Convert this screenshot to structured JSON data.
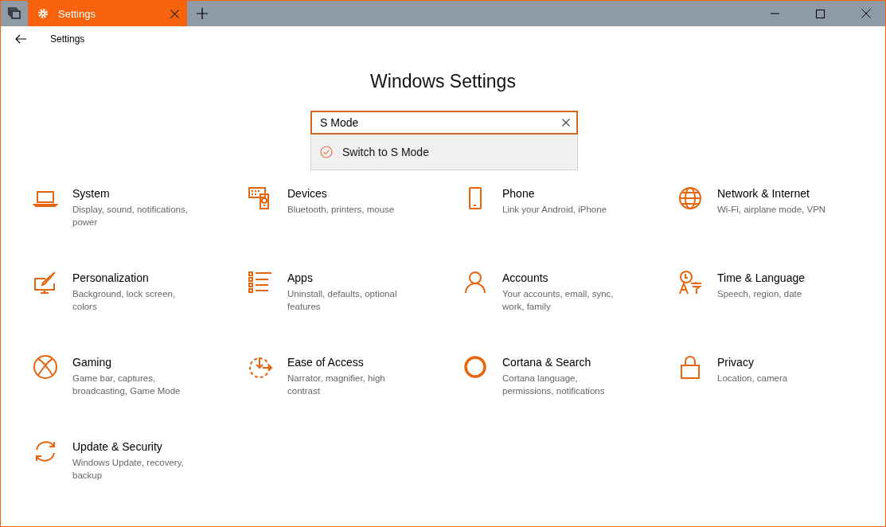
{
  "tabs": [
    {
      "label": "Settings",
      "selected": true
    }
  ],
  "header": {
    "title": "Settings"
  },
  "page_title": "Windows Settings",
  "search": {
    "value": "S Mode",
    "suggestions": [
      {
        "label": "Switch to S Mode",
        "selected": true
      }
    ]
  },
  "categories": [
    {
      "title": "System",
      "description": "Display, sound, notifications, power"
    },
    {
      "title": "Devices",
      "description": "Bluetooth, printers, mouse"
    },
    {
      "title": "Phone",
      "description": "Link your Android, iPhone"
    },
    {
      "title": "Network & Internet",
      "description": "Wi-Fi, airplane mode, VPN"
    },
    {
      "title": "Personalization",
      "description": "Background, lock screen, colors"
    },
    {
      "title": "Apps",
      "description": "Uninstall, defaults, optional features"
    },
    {
      "title": "Accounts",
      "description": "Your accounts, email, sync, work, family"
    },
    {
      "title": "Time & Language",
      "description": "Speech, region, date"
    },
    {
      "title": "Gaming",
      "description": "Game bar, captures, broadcasting, Game Mode"
    },
    {
      "title": "Ease of Access",
      "description": "Narrator, magnifier, high contrast"
    },
    {
      "title": "Cortana & Search",
      "description": "Cortana language, permissions, notifications"
    },
    {
      "title": "Privacy",
      "description": "Location, camera"
    },
    {
      "title": "Update & Security",
      "description": "Windows Update, recovery, backup"
    }
  ]
}
